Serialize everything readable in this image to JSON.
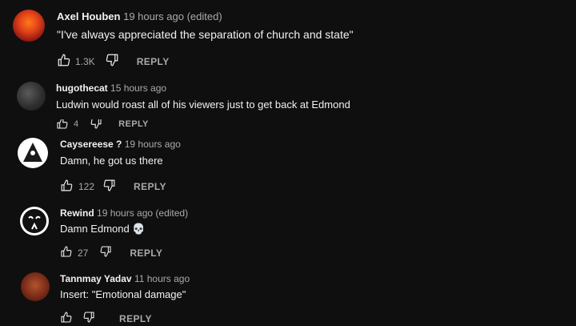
{
  "comments": [
    {
      "author": "Axel Houben",
      "time": "19 hours ago (edited)",
      "text": "\"I've always appreciated the separation of church and state\"",
      "likes": "1.3K",
      "reply_label": "REPLY"
    },
    {
      "author": "hugothecat",
      "time": "15 hours ago",
      "text": "Ludwin would roast all of his viewers just to get back at Edmond",
      "likes": "4",
      "reply_label": "REPLY"
    },
    {
      "author": "Caysereese ?",
      "time": "19 hours ago",
      "text": "Damn, he got us there",
      "likes": "122",
      "reply_label": "REPLY"
    },
    {
      "author": "Rewind",
      "time": "19 hours ago (edited)",
      "text": "Damn Edmond 💀",
      "likes": "27",
      "reply_label": "REPLY"
    },
    {
      "author": "Tannmay Yadav",
      "time": "11 hours ago",
      "text": "Insert: \"Emotional damage\"",
      "likes": "",
      "reply_label": "REPLY"
    }
  ],
  "colors": {
    "background": "#0f0f0f",
    "primary_text": "#f1f1f1",
    "secondary_text": "#aaaaaa"
  },
  "icons": [
    "thumbs-up-icon",
    "thumbs-down-icon"
  ]
}
